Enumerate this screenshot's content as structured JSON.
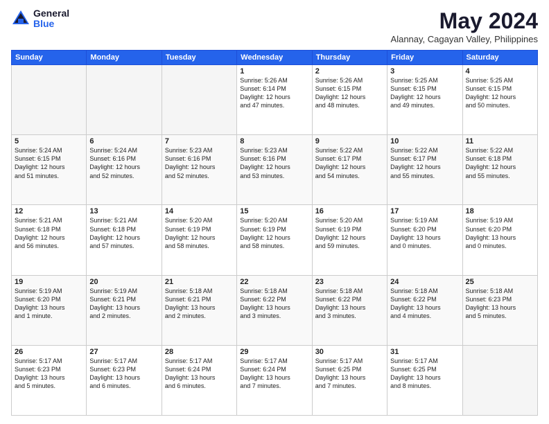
{
  "logo": {
    "general": "General",
    "blue": "Blue"
  },
  "title": "May 2024",
  "location": "Alannay, Cagayan Valley, Philippines",
  "days_header": [
    "Sunday",
    "Monday",
    "Tuesday",
    "Wednesday",
    "Thursday",
    "Friday",
    "Saturday"
  ],
  "weeks": [
    [
      {
        "day": "",
        "empty": true
      },
      {
        "day": "",
        "empty": true
      },
      {
        "day": "",
        "empty": true
      },
      {
        "day": "1",
        "info": "Sunrise: 5:26 AM\nSunset: 6:14 PM\nDaylight: 12 hours\nand 47 minutes."
      },
      {
        "day": "2",
        "info": "Sunrise: 5:26 AM\nSunset: 6:15 PM\nDaylight: 12 hours\nand 48 minutes."
      },
      {
        "day": "3",
        "info": "Sunrise: 5:25 AM\nSunset: 6:15 PM\nDaylight: 12 hours\nand 49 minutes."
      },
      {
        "day": "4",
        "info": "Sunrise: 5:25 AM\nSunset: 6:15 PM\nDaylight: 12 hours\nand 50 minutes."
      }
    ],
    [
      {
        "day": "5",
        "info": "Sunrise: 5:24 AM\nSunset: 6:15 PM\nDaylight: 12 hours\nand 51 minutes."
      },
      {
        "day": "6",
        "info": "Sunrise: 5:24 AM\nSunset: 6:16 PM\nDaylight: 12 hours\nand 52 minutes."
      },
      {
        "day": "7",
        "info": "Sunrise: 5:23 AM\nSunset: 6:16 PM\nDaylight: 12 hours\nand 52 minutes."
      },
      {
        "day": "8",
        "info": "Sunrise: 5:23 AM\nSunset: 6:16 PM\nDaylight: 12 hours\nand 53 minutes."
      },
      {
        "day": "9",
        "info": "Sunrise: 5:22 AM\nSunset: 6:17 PM\nDaylight: 12 hours\nand 54 minutes."
      },
      {
        "day": "10",
        "info": "Sunrise: 5:22 AM\nSunset: 6:17 PM\nDaylight: 12 hours\nand 55 minutes."
      },
      {
        "day": "11",
        "info": "Sunrise: 5:22 AM\nSunset: 6:18 PM\nDaylight: 12 hours\nand 55 minutes."
      }
    ],
    [
      {
        "day": "12",
        "info": "Sunrise: 5:21 AM\nSunset: 6:18 PM\nDaylight: 12 hours\nand 56 minutes."
      },
      {
        "day": "13",
        "info": "Sunrise: 5:21 AM\nSunset: 6:18 PM\nDaylight: 12 hours\nand 57 minutes."
      },
      {
        "day": "14",
        "info": "Sunrise: 5:20 AM\nSunset: 6:19 PM\nDaylight: 12 hours\nand 58 minutes."
      },
      {
        "day": "15",
        "info": "Sunrise: 5:20 AM\nSunset: 6:19 PM\nDaylight: 12 hours\nand 58 minutes."
      },
      {
        "day": "16",
        "info": "Sunrise: 5:20 AM\nSunset: 6:19 PM\nDaylight: 12 hours\nand 59 minutes."
      },
      {
        "day": "17",
        "info": "Sunrise: 5:19 AM\nSunset: 6:20 PM\nDaylight: 13 hours\nand 0 minutes."
      },
      {
        "day": "18",
        "info": "Sunrise: 5:19 AM\nSunset: 6:20 PM\nDaylight: 13 hours\nand 0 minutes."
      }
    ],
    [
      {
        "day": "19",
        "info": "Sunrise: 5:19 AM\nSunset: 6:20 PM\nDaylight: 13 hours\nand 1 minute."
      },
      {
        "day": "20",
        "info": "Sunrise: 5:19 AM\nSunset: 6:21 PM\nDaylight: 13 hours\nand 2 minutes."
      },
      {
        "day": "21",
        "info": "Sunrise: 5:18 AM\nSunset: 6:21 PM\nDaylight: 13 hours\nand 2 minutes."
      },
      {
        "day": "22",
        "info": "Sunrise: 5:18 AM\nSunset: 6:22 PM\nDaylight: 13 hours\nand 3 minutes."
      },
      {
        "day": "23",
        "info": "Sunrise: 5:18 AM\nSunset: 6:22 PM\nDaylight: 13 hours\nand 3 minutes."
      },
      {
        "day": "24",
        "info": "Sunrise: 5:18 AM\nSunset: 6:22 PM\nDaylight: 13 hours\nand 4 minutes."
      },
      {
        "day": "25",
        "info": "Sunrise: 5:18 AM\nSunset: 6:23 PM\nDaylight: 13 hours\nand 5 minutes."
      }
    ],
    [
      {
        "day": "26",
        "info": "Sunrise: 5:17 AM\nSunset: 6:23 PM\nDaylight: 13 hours\nand 5 minutes."
      },
      {
        "day": "27",
        "info": "Sunrise: 5:17 AM\nSunset: 6:23 PM\nDaylight: 13 hours\nand 6 minutes."
      },
      {
        "day": "28",
        "info": "Sunrise: 5:17 AM\nSunset: 6:24 PM\nDaylight: 13 hours\nand 6 minutes."
      },
      {
        "day": "29",
        "info": "Sunrise: 5:17 AM\nSunset: 6:24 PM\nDaylight: 13 hours\nand 7 minutes."
      },
      {
        "day": "30",
        "info": "Sunrise: 5:17 AM\nSunset: 6:25 PM\nDaylight: 13 hours\nand 7 minutes."
      },
      {
        "day": "31",
        "info": "Sunrise: 5:17 AM\nSunset: 6:25 PM\nDaylight: 13 hours\nand 8 minutes."
      },
      {
        "day": "",
        "empty": true
      }
    ]
  ]
}
